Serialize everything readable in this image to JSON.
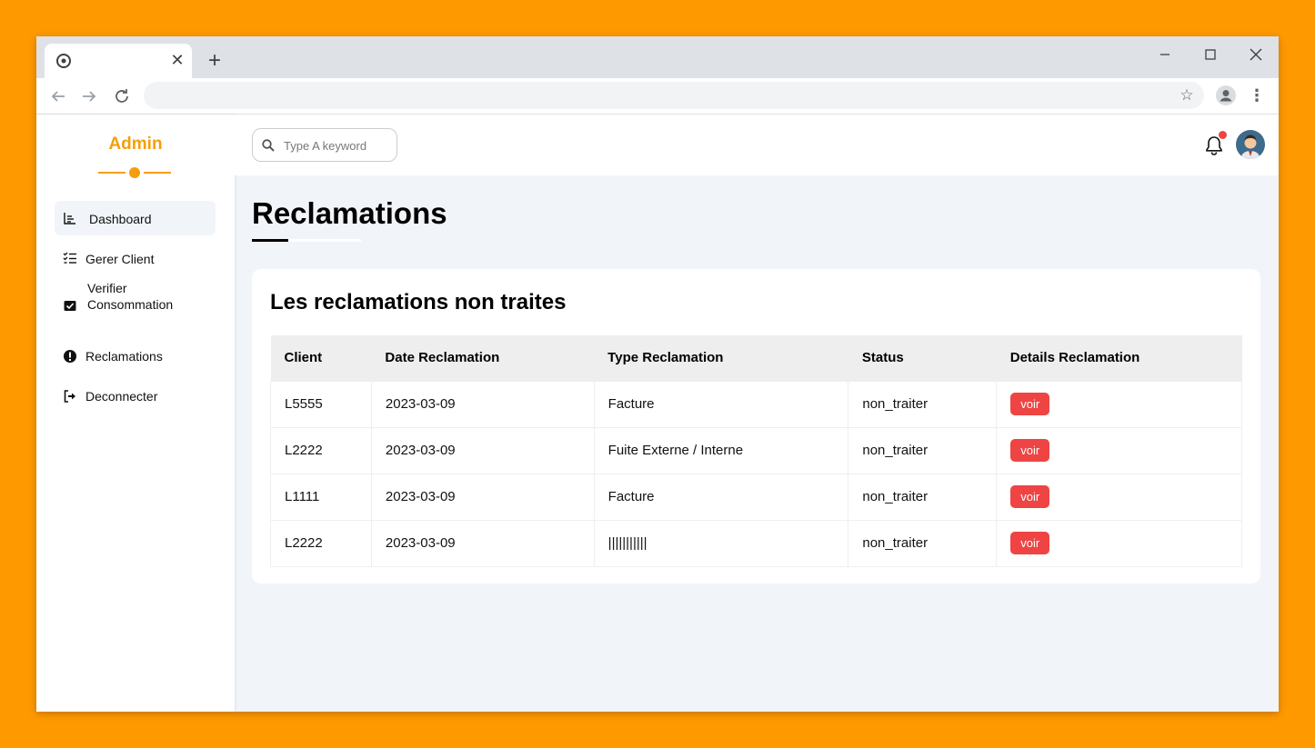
{
  "browser": {
    "tab_close": "✕",
    "new_tab": "+"
  },
  "sidebar": {
    "brand": "Admin",
    "items": [
      {
        "label": "Dashboard",
        "icon": "chart-icon"
      },
      {
        "label": "Gerer Client",
        "icon": "checklist-icon"
      },
      {
        "label": "Verifier Consommation",
        "icon": "check-box-icon"
      },
      {
        "label": "Reclamations",
        "icon": "exclamation-circle-icon"
      },
      {
        "label": "Deconnecter",
        "icon": "sign-out-icon"
      }
    ]
  },
  "header": {
    "search_placeholder": "Type A keyword"
  },
  "main": {
    "title": "Reclamations",
    "card_title": "Les reclamations non traites",
    "table": {
      "columns": [
        "Client",
        "Date Reclamation",
        "Type Reclamation",
        "Status",
        "Details Reclamation"
      ],
      "rows": [
        {
          "client": "L5555",
          "date": "2023-03-09",
          "type": "Facture",
          "status": "non_traiter",
          "action": "voir"
        },
        {
          "client": "L2222",
          "date": "2023-03-09",
          "type": "Fuite Externe / Interne",
          "status": "non_traiter",
          "action": "voir"
        },
        {
          "client": "L1111",
          "date": "2023-03-09",
          "type": "Facture",
          "status": "non_traiter",
          "action": "voir"
        },
        {
          "client": "L2222",
          "date": "2023-03-09",
          "type": "|||||||||||",
          "status": "non_traiter",
          "action": "voir"
        }
      ]
    }
  },
  "colors": {
    "background": "#ff9900",
    "accent": "#f59e0b",
    "button": "#ef4444"
  }
}
